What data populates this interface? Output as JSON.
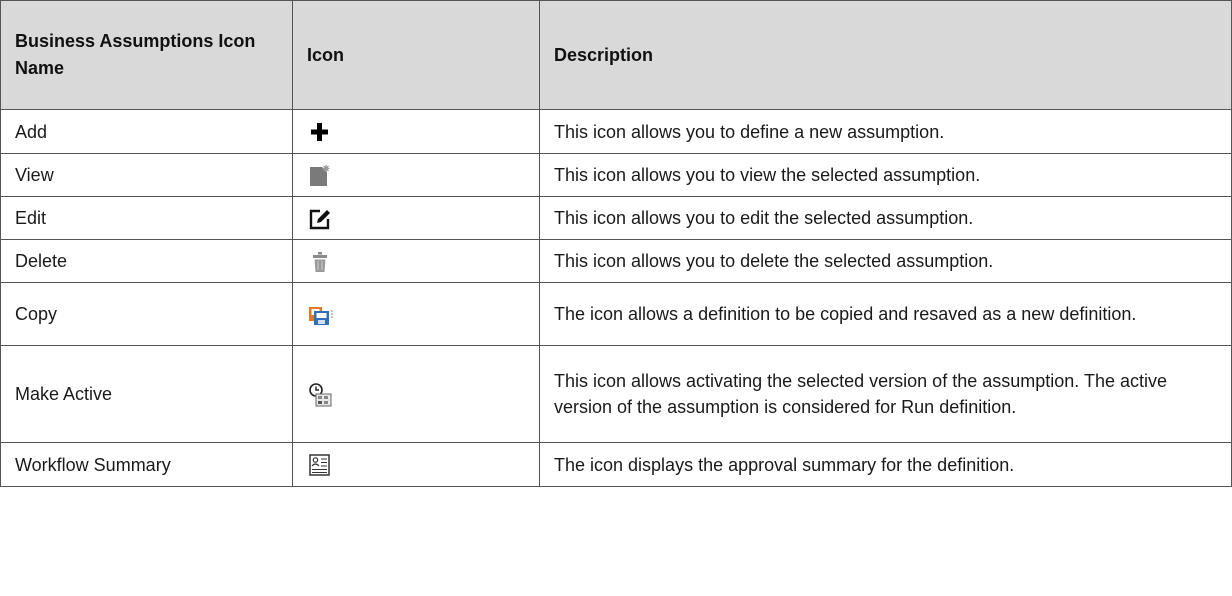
{
  "table": {
    "headers": {
      "name": "Business Assumptions Icon Name",
      "icon": "Icon",
      "description": "Description"
    },
    "rows": [
      {
        "name": "Add",
        "icon": "add-plus-icon",
        "description": "This icon allows you to define a new assumption."
      },
      {
        "name": "View",
        "icon": "view-document-icon",
        "description": "This icon allows you to view the selected assumption."
      },
      {
        "name": "Edit",
        "icon": "edit-pencil-icon",
        "description": "This icon allows you to edit the selected assumption."
      },
      {
        "name": "Delete",
        "icon": "delete-trash-icon",
        "description": "This icon allows you to delete the selected assumption."
      },
      {
        "name": "Copy",
        "icon": "copy-save-icon",
        "description": "The icon allows a definition to be copied and resaved as a new definition."
      },
      {
        "name": "Make Active",
        "icon": "make-active-clock-icon",
        "description": "This icon allows activating the selected version of the assumption. The active version of the assumption is considered for Run definition."
      },
      {
        "name": "Workflow Summary",
        "icon": "workflow-summary-icon",
        "description": "The icon displays the approval summary for the definition."
      }
    ]
  }
}
